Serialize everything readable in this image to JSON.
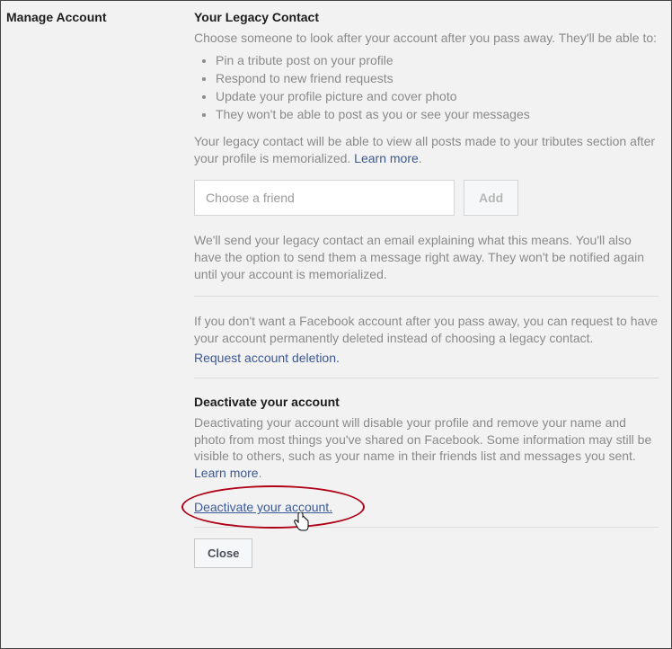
{
  "leftNav": {
    "heading": "Manage Account"
  },
  "legacy": {
    "title": "Your Legacy Contact",
    "intro": "Choose someone to look after your account after you pass away. They'll be able to:",
    "bullets": [
      "Pin a tribute post on your profile",
      "Respond to new friend requests",
      "Update your profile picture and cover photo",
      "They won't be able to post as you or see your messages"
    ],
    "memorialized_text": "Your legacy contact will be able to view all posts made to your tributes section after your profile is memorialized. ",
    "learn_more": "Learn more",
    "friend_placeholder": "Choose a friend",
    "add_label": "Add",
    "email_note": "We'll send your legacy contact an email explaining what this means. You'll also have the option to send them a message right away. They won't be notified again until your account is memorialized.",
    "deletion_intro": "If you don't want a Facebook account after you pass away, you can request to have your account permanently deleted instead of choosing a legacy contact.",
    "request_deletion": "Request account deletion."
  },
  "deactivate": {
    "title": "Deactivate your account",
    "desc": "Deactivating your account will disable your profile and remove your name and photo from most things you've shared on Facebook. Some information may still be visible to others, such as your name in their friends list and messages you sent. ",
    "learn_more": "Learn more",
    "link": "Deactivate your account."
  },
  "footer": {
    "close_label": "Close"
  }
}
